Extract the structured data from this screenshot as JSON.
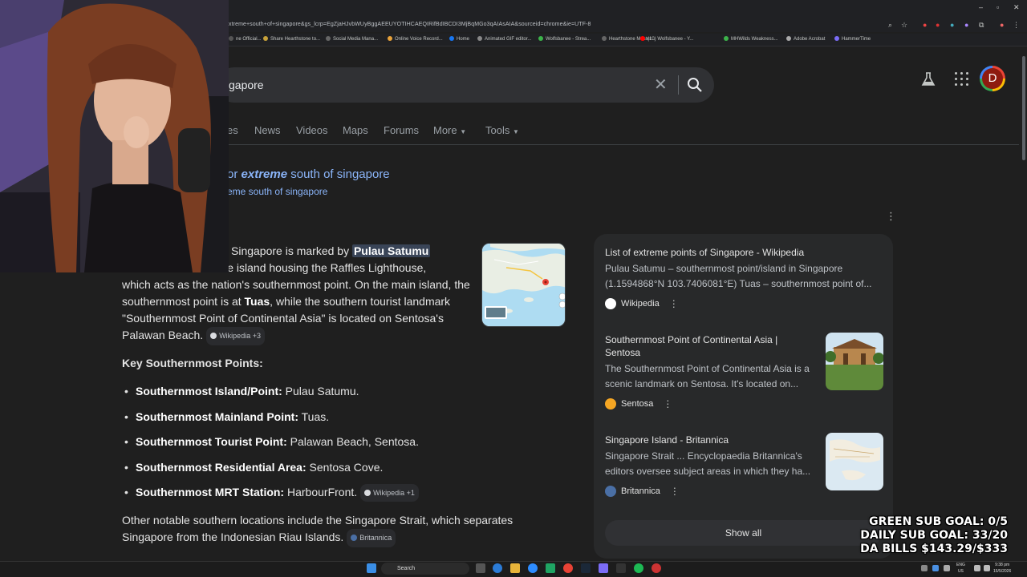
{
  "browser": {
    "url": "xtreme+south+of+singapore&gs_lcrp=EgZjaHJvbWUyBggAEEUYOTIHCAEQIRifBdIBCDI3MjBqMGo3qAIAsAIA&sourceid=chrome&ie=UTF-8",
    "window_controls": {
      "minimize": "–",
      "maximize": "▫",
      "close": "✕"
    },
    "bookmarks": [
      {
        "label": "ne Official...",
        "color": "#555"
      },
      {
        "label": "Share Hearthstone to...",
        "color": "#c8a23a"
      },
      {
        "label": "Social Media Mana...",
        "color": "#666"
      },
      {
        "label": "Online Voice Record...",
        "color": "#e8a23a"
      },
      {
        "label": "Home",
        "color": "#1877f2"
      },
      {
        "label": "Animated GIF editor...",
        "color": "#888"
      },
      {
        "label": "Wolfsbanee - Strea...",
        "color": "#3cb34a"
      },
      {
        "label": "Hearthstone Master...",
        "color": "#666"
      },
      {
        "label": "(10) Wolfsbanee - Y...",
        "color": "#ff0000"
      },
      {
        "label": "MHWilds Weakness...",
        "color": "#3cb34a"
      },
      {
        "label": "Adobe Acrobat",
        "color": "#aaa"
      },
      {
        "label": "HammerTime",
        "color": "#7b6cf6"
      }
    ]
  },
  "search": {
    "query": "gapore",
    "clear_icon": "✕",
    "avatar_letter": "D"
  },
  "tabs": [
    "es",
    "News",
    "Videos",
    "Maps",
    "Forums",
    "More",
    "Tools"
  ],
  "spelling": {
    "showing_prefix": "or ",
    "showing_emph": "extreme",
    "showing_rest": " south of singapore",
    "instead": "eme south of singapore"
  },
  "overview": {
    "line1_pre": "Singapore is marked by ",
    "line1_hl": "Pulau Satumu",
    "line2": "shore island housing the Raffles Lighthouse,",
    "line3": "which acts as the nation's southernmost point. On the main island, the",
    "line4_pre": "southernmost point is at ",
    "line4_b": "Tuas",
    "line4_post": ", while the southern tourist landmark",
    "line5": "\"Southernmost Point of Continental Asia\" is located on Sentosa's",
    "line6": "Palawan Beach.",
    "chip1": "Wikipedia +3"
  },
  "key_points": {
    "heading": "Key Southernmost Points:",
    "items": [
      {
        "label": "Southernmost Island/Point:",
        "value": " Pulau Satumu."
      },
      {
        "label": "Southernmost Mainland Point:",
        "value": " Tuas."
      },
      {
        "label": "Southernmost Tourist Point:",
        "value": " Palawan Beach, Sentosa."
      },
      {
        "label": "Southernmost Residential Area:",
        "value": " Sentosa Cove."
      },
      {
        "label": "Southernmost MRT Station:",
        "value": " HarbourFront."
      }
    ],
    "chip": "Wikipedia +1"
  },
  "other": {
    "line1": "Other notable southern locations include the Singapore Strait, which separates",
    "line2": "Singapore from the Indonesian Riau Islands.",
    "chip": "Britannica"
  },
  "sources": [
    {
      "title": "List of extreme points of Singapore - Wikipedia",
      "snippet1": "Pulau Satumu – southernmost point/island in Singapore",
      "snippet2": "(1.1594868°N 103.7406081°E) Tuas – southernmost point of...",
      "site": "Wikipedia",
      "fav_color": "#ffffff"
    },
    {
      "title1": "Southernmost Point of Continental Asia |",
      "title2": "Sentosa",
      "snippet1": "The Southernmost Point of Continental Asia is a",
      "snippet2": "scenic landmark on Sentosa. It's located on...",
      "site": "Sentosa",
      "fav_color": "#f5a623"
    },
    {
      "title": "Singapore Island - Britannica",
      "snippet1": "Singapore Strait ... Encyclopaedia Britannica's",
      "snippet2": "editors oversee subject areas in which they ha...",
      "site": "Britannica",
      "fav_color": "#4a6fa5"
    }
  ],
  "show_all": "Show all",
  "overlay": {
    "line1": "GREEN SUB GOAL: 0/5",
    "line2": "DAILY SUB GOAL: 33/20",
    "line3": "DA BILLS $143.29/$333"
  },
  "taskbar": {
    "search": "Search",
    "lang1": "ENG",
    "lang2": "US",
    "time": "9:38 pm",
    "date": "15/5/2026"
  }
}
